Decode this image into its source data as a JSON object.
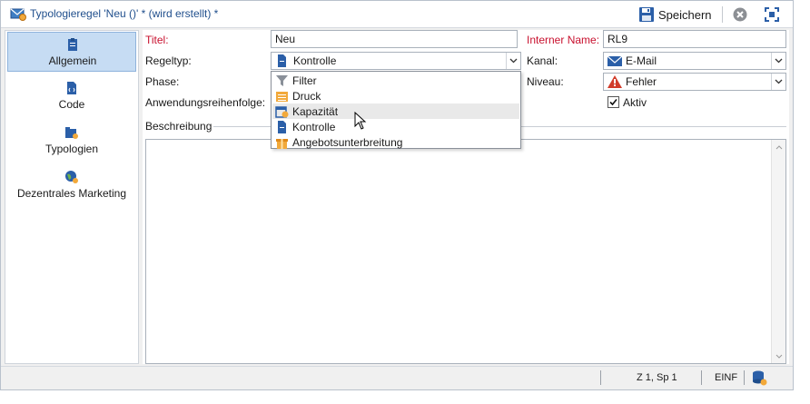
{
  "window": {
    "title": "Typologieregel 'Neu ()' * (wird erstellt) *",
    "toolbar": {
      "save_label": "Speichern"
    }
  },
  "sidebar": {
    "items": [
      {
        "label": "Allgemein",
        "icon": "clipboard-icon",
        "active": true
      },
      {
        "label": "Code",
        "icon": "script-icon",
        "active": false
      },
      {
        "label": "Typologien",
        "icon": "typology-icon",
        "active": false
      },
      {
        "label": "Dezentrales Marketing",
        "icon": "globe-icon",
        "active": false
      }
    ]
  },
  "form": {
    "title_label": "Titel:",
    "title_value": "Neu",
    "internal_name_label": "Interner Name:",
    "internal_name_value": "RL9",
    "rule_type_label": "Regeltyp:",
    "rule_type_value": "Kontrolle",
    "channel_label": "Kanal:",
    "channel_value": "E-Mail",
    "phase_label": "Phase:",
    "level_label": "Niveau:",
    "level_value": "Fehler",
    "order_label": "Anwendungsreihenfolge:",
    "active_label": "Aktiv",
    "active_checked": true,
    "description_label": "Beschreibung"
  },
  "dropdown": {
    "items": [
      {
        "label": "Filter",
        "icon": "filter-icon"
      },
      {
        "label": "Druck",
        "icon": "print-icon"
      },
      {
        "label": "Kapazität",
        "icon": "capacity-icon",
        "hovered": true
      },
      {
        "label": "Kontrolle",
        "icon": "control-icon"
      },
      {
        "label": "Angebotsunterbreitung",
        "icon": "offer-icon"
      }
    ]
  },
  "statusbar": {
    "position": "Z 1, Sp 1",
    "mode": "EINF"
  },
  "colors": {
    "accent": "#1f4e8c",
    "required": "#c8102e",
    "selection": "#c6dcf3"
  }
}
